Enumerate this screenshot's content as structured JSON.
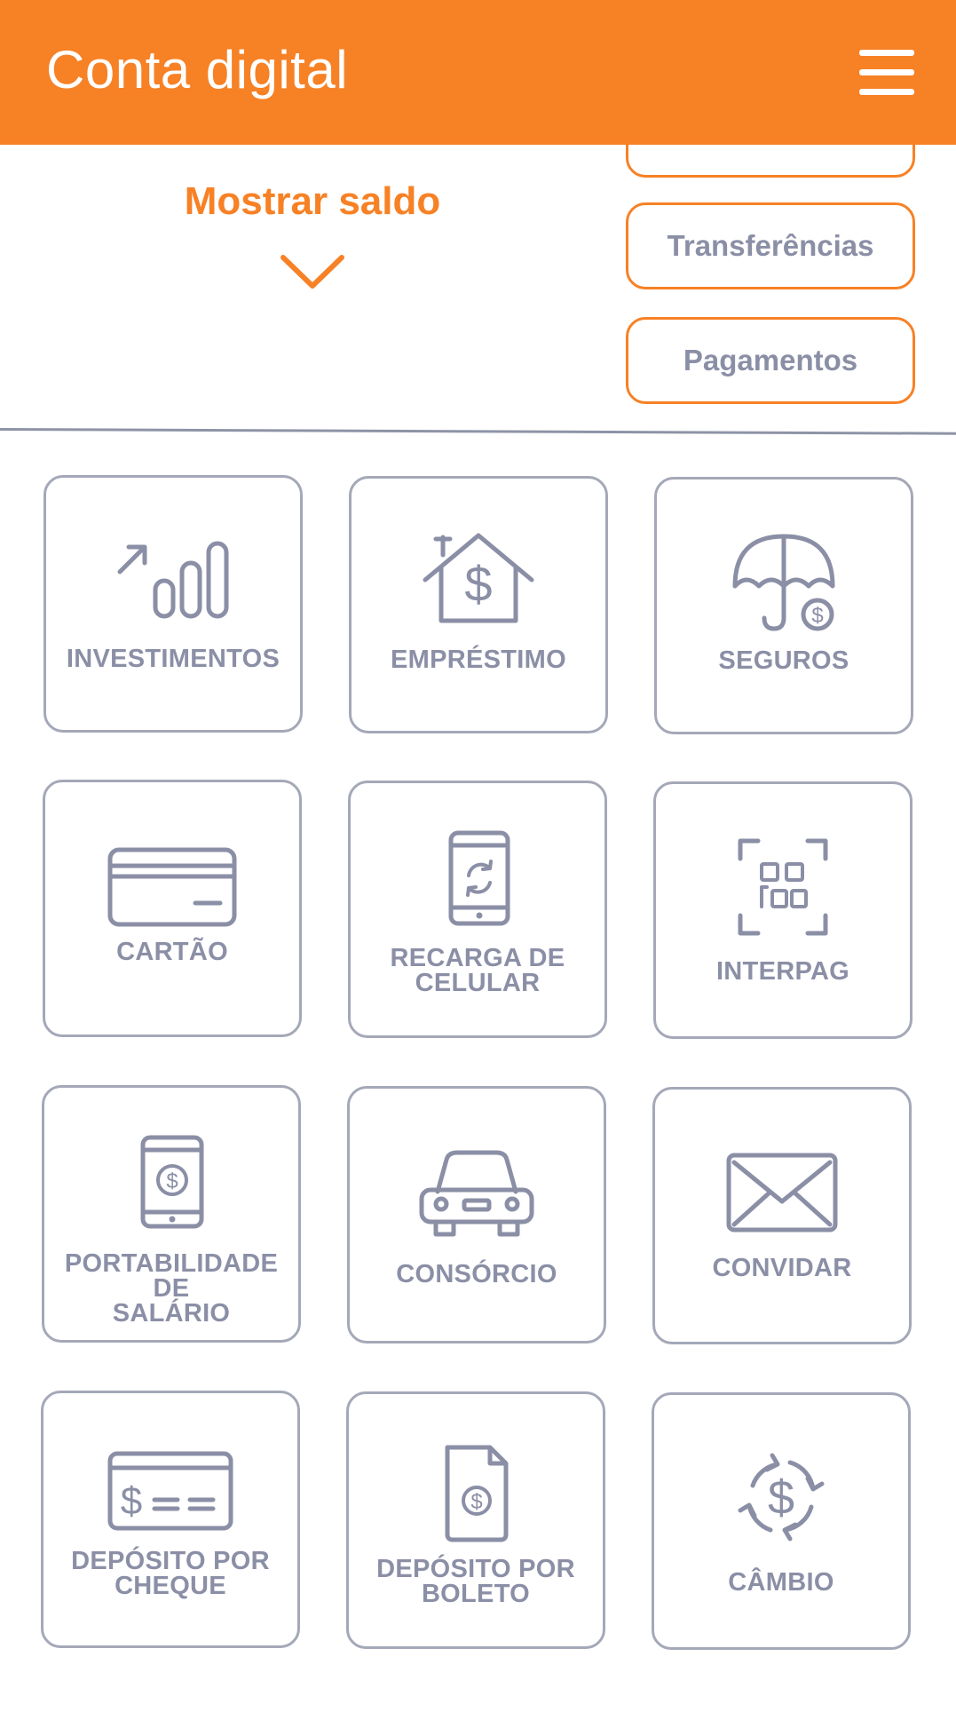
{
  "header": {
    "title": "Conta digital"
  },
  "balance": {
    "label": "Mostrar saldo"
  },
  "quick_actions": [
    {
      "label": ""
    },
    {
      "label": "Transferências"
    },
    {
      "label": "Pagamentos"
    }
  ],
  "tiles": [
    {
      "label": "INVESTIMENTOS",
      "icon": "investments-chart-icon"
    },
    {
      "label": "EMPRÉSTIMO",
      "icon": "house-dollar-icon"
    },
    {
      "label": "SEGUROS",
      "icon": "umbrella-dollar-icon"
    },
    {
      "label": "CARTÃO",
      "icon": "credit-card-icon"
    },
    {
      "label": "RECARGA DE CELULAR",
      "icon": "phone-recharge-icon"
    },
    {
      "label": "INTERPAG",
      "icon": "qr-code-icon"
    },
    {
      "label": "PORTABILIDADE DE SALÁRIO",
      "icon": "phone-dollar-icon"
    },
    {
      "label": "CONSÓRCIO",
      "icon": "car-icon"
    },
    {
      "label": "CONVIDAR",
      "icon": "envelope-icon"
    },
    {
      "label": "DEPÓSITO POR CHEQUE",
      "icon": "check-dollar-icon"
    },
    {
      "label": "DEPÓSITO POR BOLETO",
      "icon": "document-dollar-icon"
    },
    {
      "label": "CÂMBIO",
      "icon": "exchange-dollar-icon"
    }
  ],
  "colors": {
    "accent": "#f78125",
    "icon": "#8b8fa6",
    "border": "#a4a8b8"
  }
}
